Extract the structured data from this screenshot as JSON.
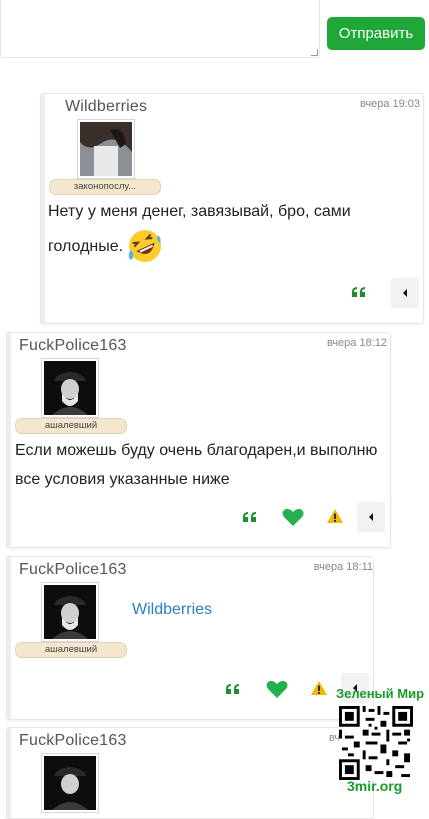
{
  "reply": {
    "send_label": "Отправить"
  },
  "posts": [
    {
      "author": "Wildberries",
      "time": "вчера 19:03",
      "rank": "законопослу...",
      "text_line1": "Нету у меня денег, завязывай, бро, сами",
      "text_line2": "голодные."
    },
    {
      "author": "FuckPolice163",
      "time": "вчера 18:12",
      "rank": "ашалевший",
      "text_line1": "Если можешь буду очень благодарен,и выполню",
      "text_line2": "все условия указанные ниже"
    },
    {
      "author": "FuckPolice163",
      "time": "вчера 18:11",
      "rank": "ашалевший",
      "link_text": "Wildberries"
    },
    {
      "author": "FuckPolice163",
      "time": "вч"
    }
  ],
  "watermark": {
    "title": "Зеленый Мир",
    "url": "3mir.org"
  },
  "colors": {
    "accent_green": "#1fa838",
    "heart_green": "#22b14c",
    "warn_yellow": "#f2b705",
    "link_blue": "#2e7fc2"
  },
  "icons": [
    "quote-icon",
    "heart-icon",
    "warning-icon",
    "caret-left-icon",
    "laughing-emoji-icon",
    "qr-code-icon"
  ]
}
